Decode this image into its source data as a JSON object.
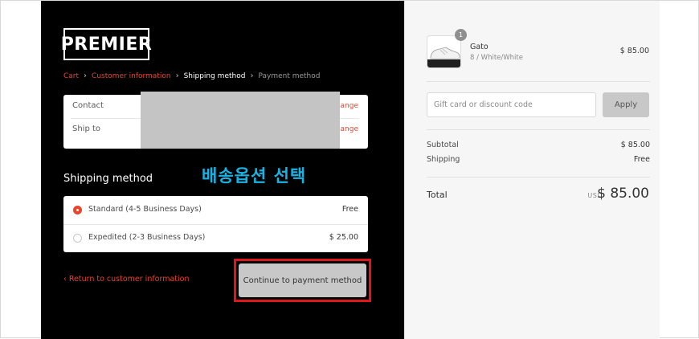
{
  "brand": {
    "logo_text": "PREMIER"
  },
  "breadcrumb": {
    "items": [
      "Cart",
      "Customer information",
      "Shipping method",
      "Payment method"
    ],
    "separator": "›"
  },
  "contact_box": {
    "contact_label": "Contact",
    "ship_to_label": "Ship to",
    "change_label": "Change"
  },
  "shipping": {
    "title": "Shipping method",
    "annotation": "배송옵션 선택",
    "options": [
      {
        "name": "Standard (4-5 Business Days)",
        "price": "Free",
        "selected": true
      },
      {
        "name": "Expedited (2-3 Business Days)",
        "price": "$ 25.00",
        "selected": false
      }
    ]
  },
  "actions": {
    "return_link": "‹ Return to customer information",
    "continue_button": "Continue to payment method"
  },
  "summary": {
    "product": {
      "name": "Gato",
      "variant": "8 / White/White",
      "price": "$ 85.00",
      "quantity": "1",
      "image_icon": "sneaker-icon"
    },
    "discount": {
      "placeholder": "Gift card or discount code",
      "apply_label": "Apply"
    },
    "subtotal_label": "Subtotal",
    "subtotal_value": "$ 85.00",
    "shipping_label": "Shipping",
    "shipping_value": "Free",
    "total_label": "Total",
    "total_currency": "USD",
    "total_value": "$ 85.00"
  },
  "colors": {
    "accent": "#e8452c",
    "annotation": "#16b4e4",
    "highlight_box": "#e0161d",
    "left_background": "#000000",
    "right_background": "#f6f6f6"
  }
}
